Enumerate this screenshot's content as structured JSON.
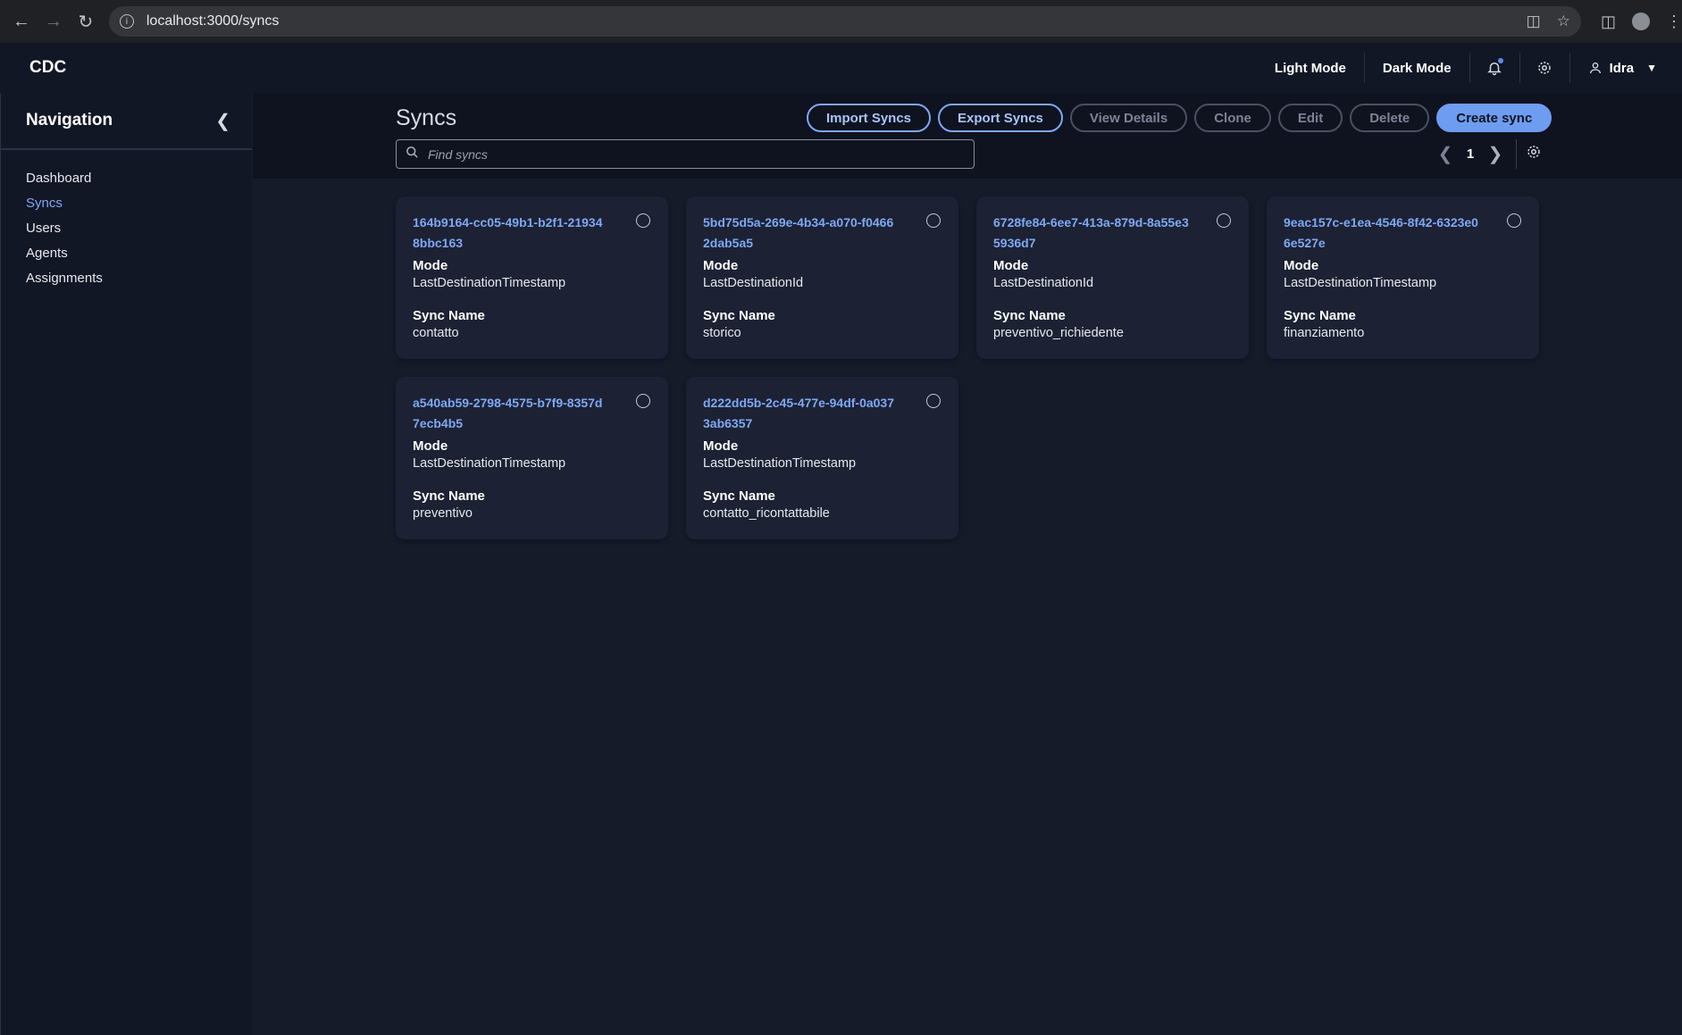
{
  "browser": {
    "url": "localhost:3000/syncs"
  },
  "app": {
    "brand": "CDC",
    "light_mode_label": "Light Mode",
    "dark_mode_label": "Dark Mode",
    "user_name": "Idra"
  },
  "sidebar": {
    "title": "Navigation",
    "items": [
      {
        "label": "Dashboard",
        "active": false
      },
      {
        "label": "Syncs",
        "active": true
      },
      {
        "label": "Users",
        "active": false
      },
      {
        "label": "Agents",
        "active": false
      },
      {
        "label": "Assignments",
        "active": false
      }
    ]
  },
  "main": {
    "title": "Syncs",
    "actions": {
      "import": "Import Syncs",
      "export": "Export Syncs",
      "view_details": "View Details",
      "clone": "Clone",
      "edit": "Edit",
      "delete": "Delete",
      "create": "Create sync"
    },
    "search": {
      "placeholder": "Find syncs",
      "value": ""
    },
    "pager": {
      "page": "1"
    },
    "field_labels": {
      "mode": "Mode",
      "sync_name": "Sync Name"
    },
    "cards": [
      {
        "id": "164b9164-cc05-49b1-b2f1-219348bbc163",
        "mode": "LastDestinationTimestamp",
        "sync_name": "contatto"
      },
      {
        "id": "5bd75d5a-269e-4b34-a070-f04662dab5a5",
        "mode": "LastDestinationId",
        "sync_name": "storico"
      },
      {
        "id": "6728fe84-6ee7-413a-879d-8a55e35936d7",
        "mode": "LastDestinationId",
        "sync_name": "preventivo_richiedente"
      },
      {
        "id": "9eac157c-e1ea-4546-8f42-6323e06e527e",
        "mode": "LastDestinationTimestamp",
        "sync_name": "finanziamento"
      },
      {
        "id": "a540ab59-2798-4575-b7f9-8357d7ecb4b5",
        "mode": "LastDestinationTimestamp",
        "sync_name": "preventivo"
      },
      {
        "id": "d222dd5b-2c45-477e-94df-0a0373ab6357",
        "mode": "LastDestinationTimestamp",
        "sync_name": "contatto_ricontattabile"
      }
    ]
  },
  "colors": {
    "accent": "#7fa8f5",
    "primary_button": "#6e9cf0",
    "background": "#161b2a",
    "panel": "#121726",
    "card": "#1c2233"
  }
}
